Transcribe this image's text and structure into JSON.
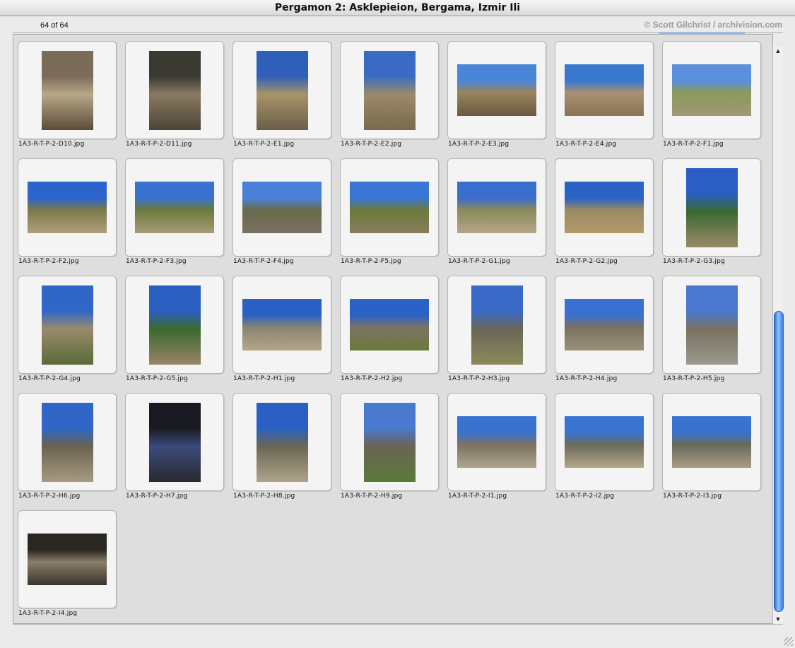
{
  "window": {
    "title": "Pergamon 2: Asklepieion, Bergama, Izmir Ili"
  },
  "header": {
    "count": "64 of 64",
    "credit": "© Scott Gilchrist / archivision.com"
  },
  "thumbnails": [
    {
      "name": "1A3-R-T-P-2-D10.jpg",
      "orientation": "portrait",
      "colors": [
        "#7a6c58",
        "#b8a888",
        "#5a4c3a"
      ]
    },
    {
      "name": "1A3-R-T-P-2-D11.jpg",
      "orientation": "portrait",
      "colors": [
        "#3a3a32",
        "#8a7a62",
        "#4a4436"
      ]
    },
    {
      "name": "1A3-R-T-P-2-E1.jpg",
      "orientation": "portrait",
      "colors": [
        "#2f5fb8",
        "#a89468",
        "#6a5e48"
      ]
    },
    {
      "name": "1A3-R-T-P-2-E2.jpg",
      "orientation": "portrait",
      "colors": [
        "#3a6ac4",
        "#9a8a6a",
        "#7a6a4c"
      ]
    },
    {
      "name": "1A3-R-T-P-2-E3.jpg",
      "orientation": "landscape",
      "colors": [
        "#4a86d8",
        "#9a845c",
        "#6a5a40"
      ]
    },
    {
      "name": "1A3-R-T-P-2-E4.jpg",
      "orientation": "landscape",
      "colors": [
        "#3a78d0",
        "#a89070",
        "#8a7456"
      ]
    },
    {
      "name": "1A3-R-T-P-2-F1.jpg",
      "orientation": "landscape",
      "colors": [
        "#5a90de",
        "#8a9a5a",
        "#a09878"
      ]
    },
    {
      "name": "1A3-R-T-P-2-F2.jpg",
      "orientation": "landscape",
      "colors": [
        "#2a64cc",
        "#7a7a48",
        "#b0a07a"
      ]
    },
    {
      "name": "1A3-R-T-P-2-F3.jpg",
      "orientation": "landscape",
      "colors": [
        "#3a72d0",
        "#6a7a3a",
        "#a89a78"
      ]
    },
    {
      "name": "1A3-R-T-P-2-F4.jpg",
      "orientation": "landscape",
      "colors": [
        "#4a80d8",
        "#6a6a4a",
        "#7a7062"
      ]
    },
    {
      "name": "1A3-R-T-P-2-F5.jpg",
      "orientation": "landscape",
      "colors": [
        "#3a76d4",
        "#6a7a3a",
        "#8a7e5e"
      ]
    },
    {
      "name": "1A3-R-T-P-2-G1.jpg",
      "orientation": "landscape",
      "colors": [
        "#3a6ecc",
        "#8a8a5a",
        "#b4a688"
      ]
    },
    {
      "name": "1A3-R-T-P-2-G2.jpg",
      "orientation": "landscape",
      "colors": [
        "#2a62c6",
        "#9a8a62",
        "#b29a6a"
      ]
    },
    {
      "name": "1A3-R-T-P-2-G3.jpg",
      "orientation": "portrait",
      "colors": [
        "#2a5ec4",
        "#3a6a2e",
        "#9a8a6a"
      ]
    },
    {
      "name": "1A3-R-T-P-2-G4.jpg",
      "orientation": "portrait",
      "colors": [
        "#2f66c8",
        "#9a8a6a",
        "#5a6a3a"
      ]
    },
    {
      "name": "1A3-R-T-P-2-G5.jpg",
      "orientation": "portrait",
      "colors": [
        "#2a5ec0",
        "#3a6a2e",
        "#9a8468"
      ]
    },
    {
      "name": "1A3-R-T-P-2-H1.jpg",
      "orientation": "landscape",
      "colors": [
        "#2a60c4",
        "#8a8470",
        "#b4a688"
      ]
    },
    {
      "name": "1A3-R-T-P-2-H2.jpg",
      "orientation": "landscape",
      "colors": [
        "#2a62c6",
        "#7a7464",
        "#6a7a3a"
      ]
    },
    {
      "name": "1A3-R-T-P-2-H3.jpg",
      "orientation": "portrait",
      "colors": [
        "#3a6ac8",
        "#6a6658",
        "#8a8a5a"
      ]
    },
    {
      "name": "1A3-R-T-P-2-H4.jpg",
      "orientation": "landscape",
      "colors": [
        "#3a70d0",
        "#7a7060",
        "#9a927a"
      ]
    },
    {
      "name": "1A3-R-T-P-2-H5.jpg",
      "orientation": "portrait",
      "colors": [
        "#4a78d0",
        "#7a7060",
        "#9a9a90"
      ]
    },
    {
      "name": "1A3-R-T-P-2-H6.jpg",
      "orientation": "portrait",
      "colors": [
        "#2f66c8",
        "#6a6252",
        "#a89a80"
      ]
    },
    {
      "name": "1A3-R-T-P-2-H7.jpg",
      "orientation": "portrait",
      "colors": [
        "#1a1a22",
        "#3a4a7a",
        "#2a2a30"
      ]
    },
    {
      "name": "1A3-R-T-P-2-H8.jpg",
      "orientation": "portrait",
      "colors": [
        "#2a60c4",
        "#6a6654",
        "#b0a48a"
      ]
    },
    {
      "name": "1A3-R-T-P-2-H9.jpg",
      "orientation": "portrait",
      "colors": [
        "#4a7ad0",
        "#6a6454",
        "#5a7a36"
      ]
    },
    {
      "name": "1A3-R-T-P-2-I1.jpg",
      "orientation": "landscape",
      "colors": [
        "#3a72d0",
        "#7a7262",
        "#b0a48a"
      ]
    },
    {
      "name": "1A3-R-T-P-2-I2.jpg",
      "orientation": "landscape",
      "colors": [
        "#3a74d2",
        "#6a6a5a",
        "#b4a888"
      ]
    },
    {
      "name": "1A3-R-T-P-2-I3.jpg",
      "orientation": "landscape",
      "colors": [
        "#3a72d0",
        "#6a6a5a",
        "#a89c84"
      ]
    },
    {
      "name": "1A3-R-T-P-2-I4.jpg",
      "orientation": "landscape",
      "colors": [
        "#2a2622",
        "#8a7e6a",
        "#3a342c"
      ]
    }
  ]
}
